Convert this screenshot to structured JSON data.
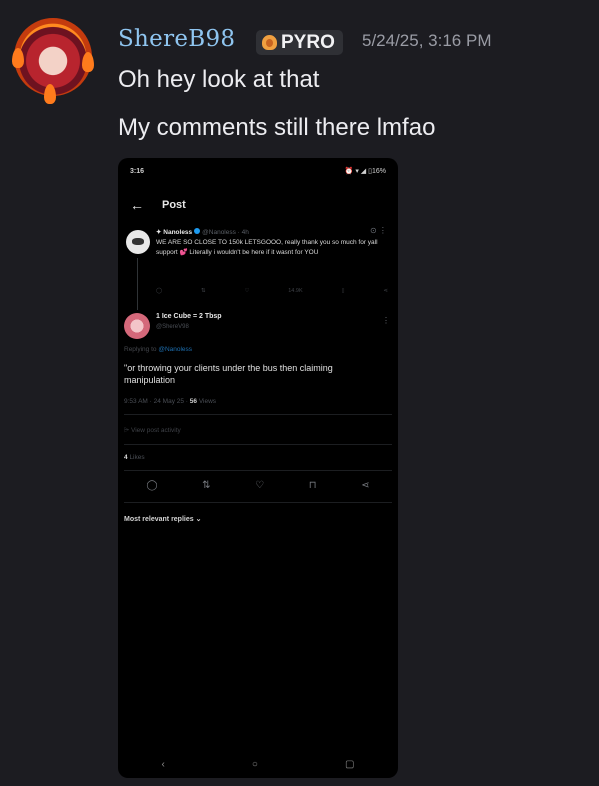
{
  "message": {
    "username": "ShereB98",
    "badge": {
      "label": "PYRO",
      "icon": "flame-icon"
    },
    "timestamp": "5/24/25, 3:16 PM",
    "lines": [
      "Oh hey look at that",
      "My comments still there lmfao"
    ]
  },
  "phone": {
    "status_time": "3:16",
    "status_right": "⏰ ▾ ◢ ▯16%",
    "header_title": "Post",
    "quoted_post": {
      "name": "Nanoless",
      "handle": "@Nanoless · 4h",
      "text": "WE ARE SO CLOSE TO 150k LETSGOOO, really thank you so much for yall support 💕 Literally i wouldn't be here if it wasnt for YOU",
      "views": "14.9K"
    },
    "reply": {
      "name": "1 Ice Cube = 2 Tbsp",
      "handle": "@ShereV98",
      "replying_prefix": "Replying to",
      "replying_to": "@Nanoless",
      "text": "\"or throwing your clients under the bus then claiming manipulation",
      "meta_time": "9:53 AM · 24 May 25 ·",
      "views_count": "56",
      "views_label": "Views"
    },
    "view_activity": "View post activity",
    "likes_count": "4",
    "likes_label": "Likes",
    "relevant_replies": "Most relevant replies ⌄"
  }
}
